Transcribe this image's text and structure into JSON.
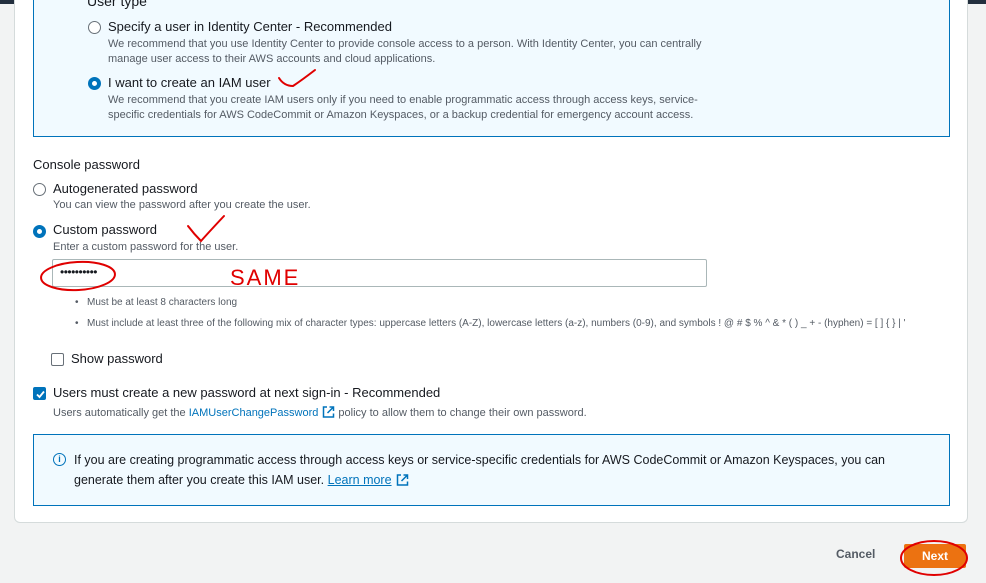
{
  "user_type": {
    "title": "User type",
    "options": [
      {
        "label": "Specify a user in Identity Center - Recommended",
        "description": "We recommend that you use Identity Center to provide console access to a person. With Identity Center, you can centrally manage user access to their AWS accounts and cloud applications.",
        "selected": false
      },
      {
        "label": "I want to create an IAM user",
        "description": "We recommend that you create IAM users only if you need to enable programmatic access through access keys, service-specific credentials for AWS CodeCommit or Amazon Keyspaces, or a backup credential for emergency account access.",
        "selected": true
      }
    ]
  },
  "console_password": {
    "title": "Console password",
    "options": [
      {
        "label": "Autogenerated password",
        "description": "You can view the password after you create the user.",
        "selected": false
      },
      {
        "label": "Custom password",
        "description": "Enter a custom password for the user.",
        "selected": true
      }
    ],
    "input_value": "••••••••••",
    "rules": [
      "Must be at least 8 characters long",
      "Must include at least three of the following mix of character types: uppercase letters (A-Z), lowercase letters (a-z), numbers (0-9), and symbols ! @ # $ % ^ & * ( ) _ + - (hyphen) = [ ] { } | '"
    ],
    "show_password_label": "Show password",
    "show_password_checked": false
  },
  "reset_required": {
    "label": "Users must create a new password at next sign-in - Recommended",
    "checked": true,
    "desc_prefix": "Users automatically get the",
    "policy_link": "IAMUserChangePassword",
    "desc_suffix": "policy to allow them to change their own password."
  },
  "info": {
    "text": "If you are creating programmatic access through access keys or service-specific credentials for AWS CodeCommit or Amazon Keyspaces, you can generate them after you create this IAM user.",
    "link": "Learn more"
  },
  "annotation": {
    "text": "SAME"
  },
  "footer": {
    "cancel_label": "Cancel",
    "next_label": "Next"
  },
  "colors": {
    "accent": "#0073bb",
    "primary_button": "#ec7211",
    "annotation_red": "#e00000"
  }
}
